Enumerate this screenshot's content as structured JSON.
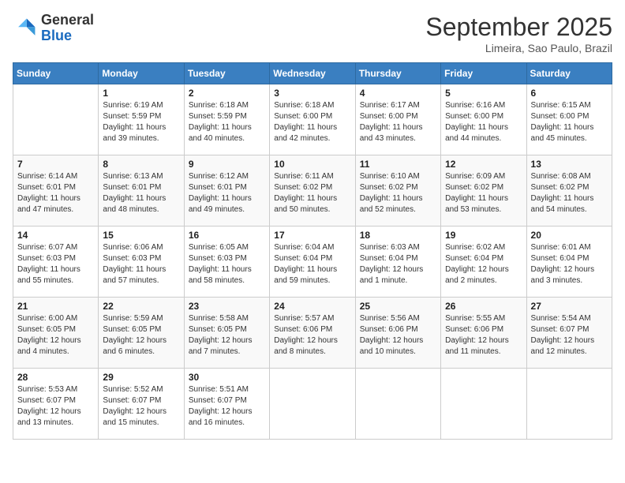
{
  "header": {
    "logo_line1": "General",
    "logo_line2": "Blue",
    "month": "September 2025",
    "location": "Limeira, Sao Paulo, Brazil"
  },
  "days_of_week": [
    "Sunday",
    "Monday",
    "Tuesday",
    "Wednesday",
    "Thursday",
    "Friday",
    "Saturday"
  ],
  "weeks": [
    [
      {
        "day": "",
        "sunrise": "",
        "sunset": "",
        "daylight": ""
      },
      {
        "day": "1",
        "sunrise": "Sunrise: 6:19 AM",
        "sunset": "Sunset: 5:59 PM",
        "daylight": "Daylight: 11 hours and 39 minutes."
      },
      {
        "day": "2",
        "sunrise": "Sunrise: 6:18 AM",
        "sunset": "Sunset: 5:59 PM",
        "daylight": "Daylight: 11 hours and 40 minutes."
      },
      {
        "day": "3",
        "sunrise": "Sunrise: 6:18 AM",
        "sunset": "Sunset: 6:00 PM",
        "daylight": "Daylight: 11 hours and 42 minutes."
      },
      {
        "day": "4",
        "sunrise": "Sunrise: 6:17 AM",
        "sunset": "Sunset: 6:00 PM",
        "daylight": "Daylight: 11 hours and 43 minutes."
      },
      {
        "day": "5",
        "sunrise": "Sunrise: 6:16 AM",
        "sunset": "Sunset: 6:00 PM",
        "daylight": "Daylight: 11 hours and 44 minutes."
      },
      {
        "day": "6",
        "sunrise": "Sunrise: 6:15 AM",
        "sunset": "Sunset: 6:00 PM",
        "daylight": "Daylight: 11 hours and 45 minutes."
      }
    ],
    [
      {
        "day": "7",
        "sunrise": "Sunrise: 6:14 AM",
        "sunset": "Sunset: 6:01 PM",
        "daylight": "Daylight: 11 hours and 47 minutes."
      },
      {
        "day": "8",
        "sunrise": "Sunrise: 6:13 AM",
        "sunset": "Sunset: 6:01 PM",
        "daylight": "Daylight: 11 hours and 48 minutes."
      },
      {
        "day": "9",
        "sunrise": "Sunrise: 6:12 AM",
        "sunset": "Sunset: 6:01 PM",
        "daylight": "Daylight: 11 hours and 49 minutes."
      },
      {
        "day": "10",
        "sunrise": "Sunrise: 6:11 AM",
        "sunset": "Sunset: 6:02 PM",
        "daylight": "Daylight: 11 hours and 50 minutes."
      },
      {
        "day": "11",
        "sunrise": "Sunrise: 6:10 AM",
        "sunset": "Sunset: 6:02 PM",
        "daylight": "Daylight: 11 hours and 52 minutes."
      },
      {
        "day": "12",
        "sunrise": "Sunrise: 6:09 AM",
        "sunset": "Sunset: 6:02 PM",
        "daylight": "Daylight: 11 hours and 53 minutes."
      },
      {
        "day": "13",
        "sunrise": "Sunrise: 6:08 AM",
        "sunset": "Sunset: 6:02 PM",
        "daylight": "Daylight: 11 hours and 54 minutes."
      }
    ],
    [
      {
        "day": "14",
        "sunrise": "Sunrise: 6:07 AM",
        "sunset": "Sunset: 6:03 PM",
        "daylight": "Daylight: 11 hours and 55 minutes."
      },
      {
        "day": "15",
        "sunrise": "Sunrise: 6:06 AM",
        "sunset": "Sunset: 6:03 PM",
        "daylight": "Daylight: 11 hours and 57 minutes."
      },
      {
        "day": "16",
        "sunrise": "Sunrise: 6:05 AM",
        "sunset": "Sunset: 6:03 PM",
        "daylight": "Daylight: 11 hours and 58 minutes."
      },
      {
        "day": "17",
        "sunrise": "Sunrise: 6:04 AM",
        "sunset": "Sunset: 6:04 PM",
        "daylight": "Daylight: 11 hours and 59 minutes."
      },
      {
        "day": "18",
        "sunrise": "Sunrise: 6:03 AM",
        "sunset": "Sunset: 6:04 PM",
        "daylight": "Daylight: 12 hours and 1 minute."
      },
      {
        "day": "19",
        "sunrise": "Sunrise: 6:02 AM",
        "sunset": "Sunset: 6:04 PM",
        "daylight": "Daylight: 12 hours and 2 minutes."
      },
      {
        "day": "20",
        "sunrise": "Sunrise: 6:01 AM",
        "sunset": "Sunset: 6:04 PM",
        "daylight": "Daylight: 12 hours and 3 minutes."
      }
    ],
    [
      {
        "day": "21",
        "sunrise": "Sunrise: 6:00 AM",
        "sunset": "Sunset: 6:05 PM",
        "daylight": "Daylight: 12 hours and 4 minutes."
      },
      {
        "day": "22",
        "sunrise": "Sunrise: 5:59 AM",
        "sunset": "Sunset: 6:05 PM",
        "daylight": "Daylight: 12 hours and 6 minutes."
      },
      {
        "day": "23",
        "sunrise": "Sunrise: 5:58 AM",
        "sunset": "Sunset: 6:05 PM",
        "daylight": "Daylight: 12 hours and 7 minutes."
      },
      {
        "day": "24",
        "sunrise": "Sunrise: 5:57 AM",
        "sunset": "Sunset: 6:06 PM",
        "daylight": "Daylight: 12 hours and 8 minutes."
      },
      {
        "day": "25",
        "sunrise": "Sunrise: 5:56 AM",
        "sunset": "Sunset: 6:06 PM",
        "daylight": "Daylight: 12 hours and 10 minutes."
      },
      {
        "day": "26",
        "sunrise": "Sunrise: 5:55 AM",
        "sunset": "Sunset: 6:06 PM",
        "daylight": "Daylight: 12 hours and 11 minutes."
      },
      {
        "day": "27",
        "sunrise": "Sunrise: 5:54 AM",
        "sunset": "Sunset: 6:07 PM",
        "daylight": "Daylight: 12 hours and 12 minutes."
      }
    ],
    [
      {
        "day": "28",
        "sunrise": "Sunrise: 5:53 AM",
        "sunset": "Sunset: 6:07 PM",
        "daylight": "Daylight: 12 hours and 13 minutes."
      },
      {
        "day": "29",
        "sunrise": "Sunrise: 5:52 AM",
        "sunset": "Sunset: 6:07 PM",
        "daylight": "Daylight: 12 hours and 15 minutes."
      },
      {
        "day": "30",
        "sunrise": "Sunrise: 5:51 AM",
        "sunset": "Sunset: 6:07 PM",
        "daylight": "Daylight: 12 hours and 16 minutes."
      },
      {
        "day": "",
        "sunrise": "",
        "sunset": "",
        "daylight": ""
      },
      {
        "day": "",
        "sunrise": "",
        "sunset": "",
        "daylight": ""
      },
      {
        "day": "",
        "sunrise": "",
        "sunset": "",
        "daylight": ""
      },
      {
        "day": "",
        "sunrise": "",
        "sunset": "",
        "daylight": ""
      }
    ]
  ]
}
